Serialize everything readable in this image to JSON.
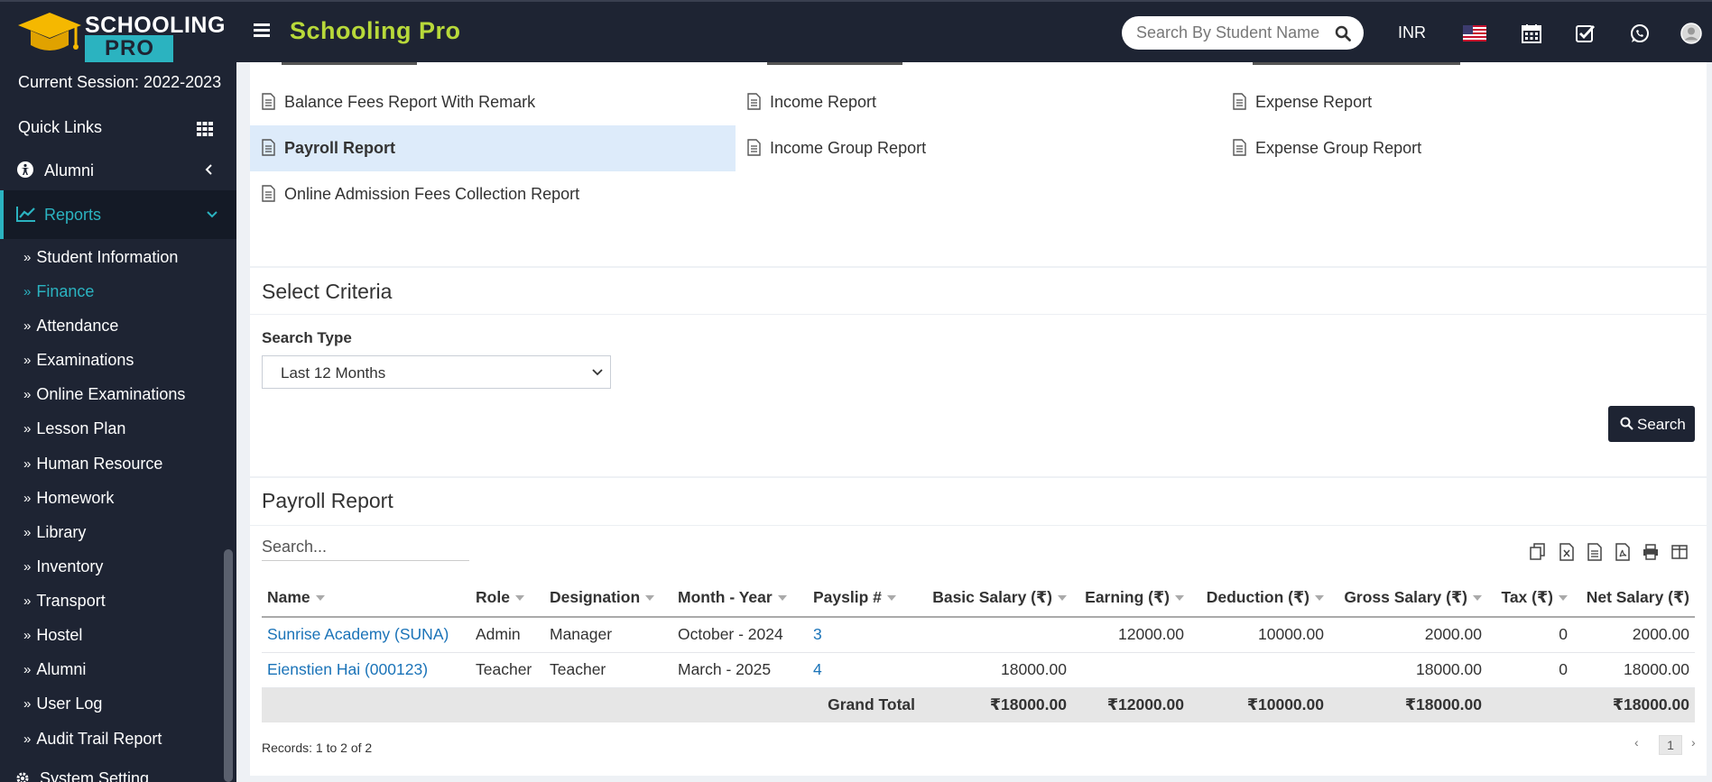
{
  "app": {
    "logo_line1": "SCHOOLING",
    "logo_line2": "PRO",
    "brand": "Schooling Pro",
    "search_placeholder": "Search By Student Name",
    "currency": "INR"
  },
  "sidebar": {
    "session": "Current Session: 2022-2023",
    "quick_links": "Quick Links",
    "alumni_top": "Alumni",
    "reports": "Reports",
    "sub_items": [
      "Student Information",
      "Finance",
      "Attendance",
      "Examinations",
      "Online Examinations",
      "Lesson Plan",
      "Human Resource",
      "Homework",
      "Library",
      "Inventory",
      "Transport",
      "Hostel",
      "Alumni",
      "User Log",
      "Audit Trail Report"
    ],
    "active_sub": "Finance",
    "system_setting": "System Setting"
  },
  "reports_menu": {
    "col1": [
      "Balance Fees Report With Remark",
      "Payroll Report",
      "Online Admission Fees Collection Report"
    ],
    "col2": [
      "Income Report",
      "Income Group Report"
    ],
    "col3": [
      "Expense Report",
      "Expense Group Report"
    ],
    "active": "Payroll Report"
  },
  "criteria": {
    "title": "Select Criteria",
    "search_type_label": "Search Type",
    "search_type_value": "Last 12 Months",
    "search_button": "Search"
  },
  "payroll": {
    "title": "Payroll Report",
    "search_placeholder": "Search...",
    "columns": [
      "Name",
      "Role",
      "Designation",
      "Month - Year",
      "Payslip #",
      "Basic Salary (₹)",
      "Earning (₹)",
      "Deduction (₹)",
      "Gross Salary (₹)",
      "Tax (₹)",
      "Net Salary (₹)"
    ],
    "rows": [
      {
        "name": "Sunrise Academy (SUNA)",
        "role": "Admin",
        "designation": "Manager",
        "month_year": "October - 2024",
        "payslip": "3",
        "basic": "",
        "earning": "12000.00",
        "deduction": "10000.00",
        "gross": "2000.00",
        "tax": "0",
        "net": "2000.00"
      },
      {
        "name": "Eienstien Hai (000123)",
        "role": "Teacher",
        "designation": "Teacher",
        "month_year": "March - 2025",
        "payslip": "4",
        "basic": "18000.00",
        "earning": "",
        "deduction": "",
        "gross": "18000.00",
        "tax": "0",
        "net": "18000.00"
      }
    ],
    "total": {
      "label": "Grand Total",
      "basic": "₹18000.00",
      "earning": "₹12000.00",
      "deduction": "₹10000.00",
      "gross": "₹18000.00",
      "tax": "",
      "net": "₹18000.00"
    },
    "records": "Records: 1 to 2 of 2",
    "page": "1",
    "prev": "‹",
    "next": "›"
  }
}
